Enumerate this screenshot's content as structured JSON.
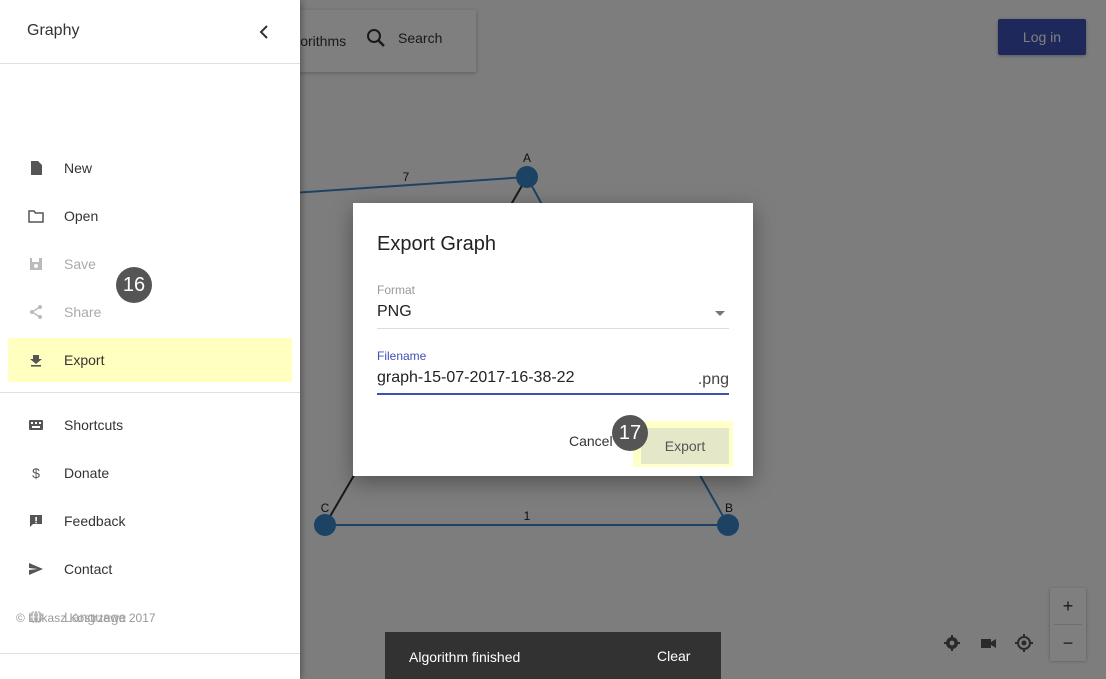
{
  "app": {
    "title": "Graphy"
  },
  "topbar": {
    "algorithms_label": "Algorithms",
    "search_label": "Search",
    "login_label": "Log in"
  },
  "drawer": {
    "items": [
      {
        "label": "New",
        "icon": "file-icon",
        "disabled": false
      },
      {
        "label": "Open",
        "icon": "folder-icon",
        "disabled": false
      },
      {
        "label": "Save",
        "icon": "save-icon",
        "disabled": true
      },
      {
        "label": "Share",
        "icon": "share-icon",
        "disabled": true
      },
      {
        "label": "Export",
        "icon": "download-icon",
        "disabled": false,
        "active": true
      },
      {
        "label": "Shortcuts",
        "icon": "keyboard-icon",
        "disabled": false
      },
      {
        "label": "Donate",
        "icon": "dollar-icon",
        "disabled": false
      },
      {
        "label": "Feedback",
        "icon": "feedback-icon",
        "disabled": false
      },
      {
        "label": "Contact",
        "icon": "send-icon",
        "disabled": false
      },
      {
        "label": "Language",
        "icon": "globe-icon",
        "disabled": true
      }
    ],
    "copyright": "© Lukasz Kostrzewa 2017"
  },
  "graph": {
    "nodes": [
      {
        "label": "A"
      },
      {
        "label": "B"
      },
      {
        "label": "C"
      }
    ],
    "edges": [
      {
        "from": "C",
        "to": "B",
        "weight": "1"
      },
      {
        "from": "off-screen",
        "to": "A",
        "weight": "7"
      }
    ]
  },
  "dialog": {
    "title": "Export Graph",
    "format_label": "Format",
    "format_value": "PNG",
    "filename_label": "Filename",
    "filename_value": "graph-15-07-2017-16-38-22",
    "filename_ext": ".png",
    "cancel_label": "Cancel",
    "export_label": "Export"
  },
  "annotations": {
    "step_16": "16",
    "step_17": "17"
  },
  "snackbar": {
    "message": "Algorithm finished",
    "action": "Clear"
  },
  "zoom": {
    "in_label": "+",
    "out_label": "−"
  },
  "colors": {
    "primary": "#3f51b5",
    "node": "#3a87c8",
    "highlight": "#ffffbf",
    "snackbar": "#323232"
  }
}
